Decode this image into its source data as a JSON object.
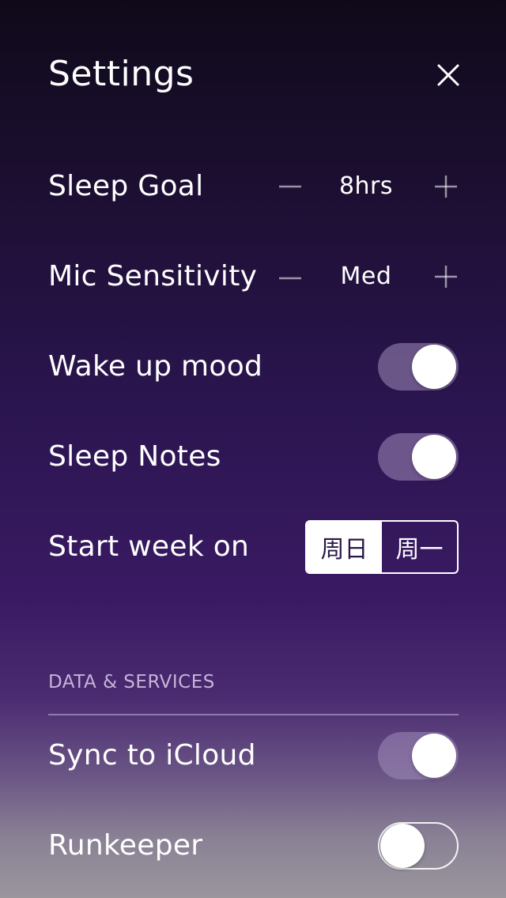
{
  "header": {
    "title": "Settings"
  },
  "sleep_goal": {
    "label": "Sleep Goal",
    "value": "8hrs"
  },
  "mic_sensitivity": {
    "label": "Mic Sensitivity",
    "value": "Med"
  },
  "wake_up_mood": {
    "label": "Wake up mood",
    "enabled": true
  },
  "sleep_notes": {
    "label": "Sleep Notes",
    "enabled": true
  },
  "start_week": {
    "label": "Start week on",
    "options": [
      "周日",
      "周一"
    ],
    "selected": "周日"
  },
  "data_services": {
    "header": "DATA & SERVICES",
    "sync_icloud": {
      "label": "Sync to iCloud",
      "enabled": true
    },
    "runkeeper": {
      "label": "Runkeeper",
      "enabled": false
    }
  },
  "icons": {
    "close": "close-icon",
    "minus": "minus-icon",
    "plus": "plus-icon"
  }
}
